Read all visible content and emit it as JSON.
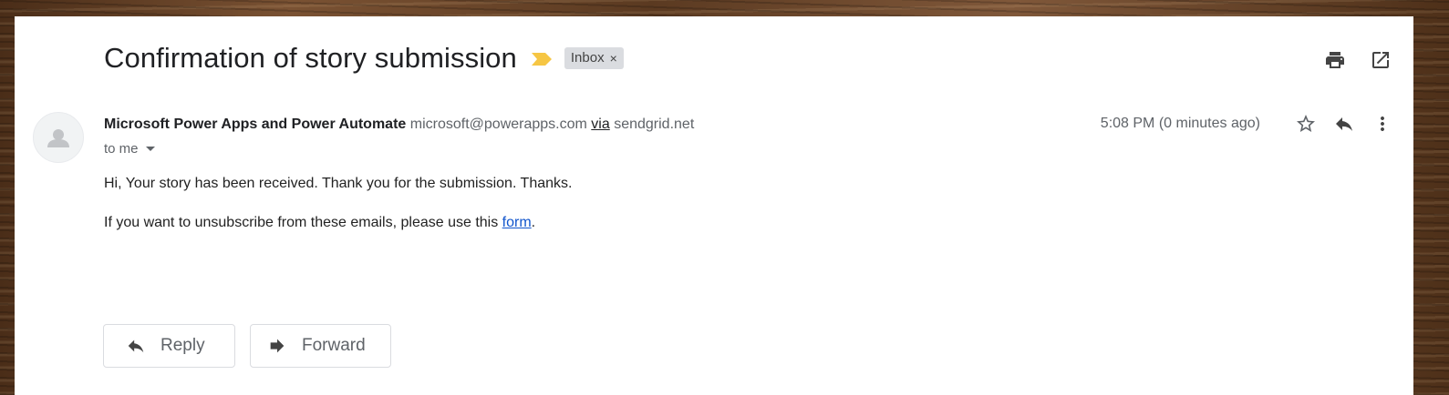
{
  "email": {
    "subject": "Confirmation of story submission",
    "label": "Inbox",
    "label_close": "×",
    "sender_name": "Microsoft Power Apps and Power Automate",
    "sender_email": "microsoft@powerapps.com",
    "via_label": "via",
    "via_domain": "sendgrid.net",
    "recipient": "to me",
    "time": "5:08 PM (0 minutes ago)",
    "body_line1": "Hi, Your story has been received. Thank you for the submission. Thanks.",
    "body_line2_prefix": "If you want to unsubscribe from these emails, please use this ",
    "body_link": "form",
    "body_line2_suffix": "."
  },
  "actions": {
    "reply_label": "Reply",
    "forward_label": "Forward"
  },
  "icons": {
    "importance": "importance-marker-icon",
    "print": "print-icon",
    "open_new_window": "open-in-new-window-icon",
    "star": "star-icon",
    "reply": "reply-icon",
    "more": "more-vert-icon",
    "forward": "forward-icon",
    "avatar": "person-icon"
  },
  "colors": {
    "importance_yellow": "#f6c644",
    "link_blue": "#1155cc",
    "chip_bg": "#dadce0"
  }
}
